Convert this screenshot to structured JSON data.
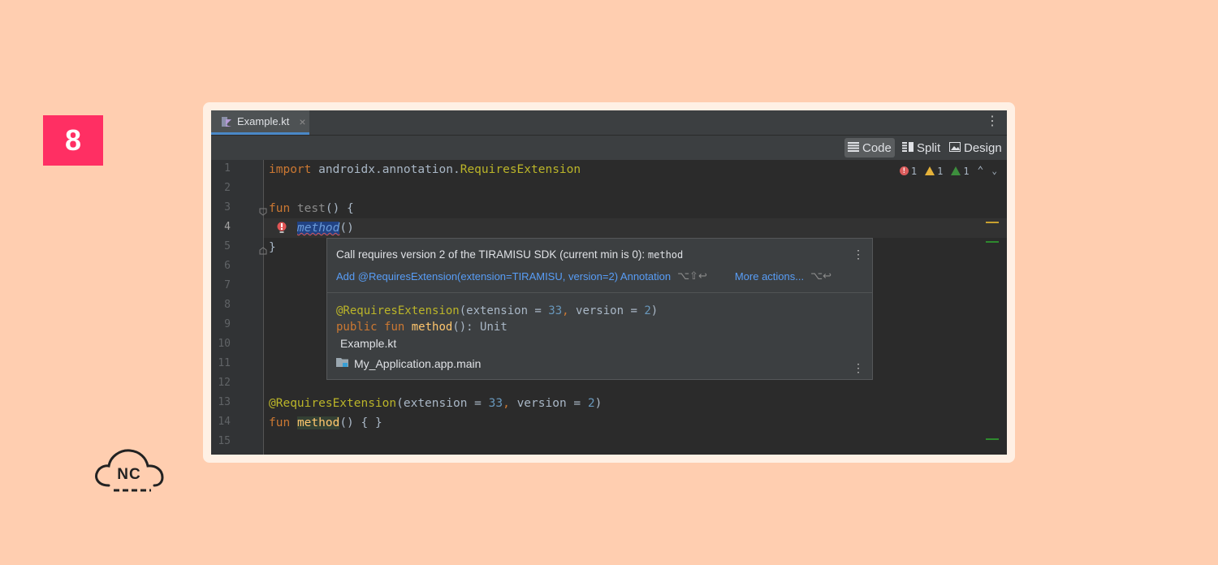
{
  "badge": {
    "number": "8"
  },
  "logo": {
    "text": "NC"
  },
  "editor": {
    "tab": {
      "filename": "Example.kt",
      "close": "×"
    },
    "view_modes": [
      "Code",
      "Split",
      "Design"
    ],
    "line_numbers": [
      "1",
      "2",
      "3",
      "4",
      "5",
      "6",
      "7",
      "8",
      "9",
      "10",
      "11",
      "12",
      "13",
      "14",
      "15"
    ],
    "current_line": "4",
    "code": {
      "l1_kw": "import",
      "l1_pkg": " androidx.annotation.",
      "l1_cls": "RequiresExtension",
      "l3_kw": "fun",
      "l3_name": " test",
      "l3_rest": "() {",
      "l4_call": "method",
      "l4_rest": "()",
      "l5": "}",
      "l13_ann": "@RequiresExtension",
      "l13_open": "(extension = ",
      "l13_num1": "33",
      "l13_comma": ", ",
      "l13_arg2": "version = ",
      "l13_num2": "2",
      "l13_close": ")",
      "l14_kw": "fun",
      "l14_name": "method",
      "l14_rest": "() { }"
    },
    "inspections": {
      "errors": "1",
      "warnings": "1",
      "weak_warnings": "1"
    }
  },
  "popup": {
    "message": "Call requires version 2 of the TIRAMISU SDK (current min is 0):",
    "message_code": "method",
    "action_primary": "Add @RequiresExtension(extension=TIRAMISU, version=2) Annotation",
    "action_primary_shortcut": "⌥⇧↩",
    "action_more": "More actions...",
    "action_more_shortcut": "⌥↩",
    "doc": {
      "ann": "@RequiresExtension",
      "ann_open": "(extension = ",
      "num1": "33",
      "comma": ", ",
      "arg2": "version = ",
      "num2": "2",
      "ann_close": ")",
      "kw1": "public",
      "kw2": "fun",
      "fn": "method",
      "sig": "(): Unit",
      "file": "Example.kt",
      "module": "My_Application.app.main"
    }
  },
  "colors": {
    "background": "#ffceb0",
    "badge": "#ff2f63",
    "editor_bg": "#2b2b2b",
    "keyword": "#cc7832",
    "annotation": "#bbb529",
    "number": "#6897bb",
    "function": "#ffc66d",
    "link": "#589df6"
  }
}
